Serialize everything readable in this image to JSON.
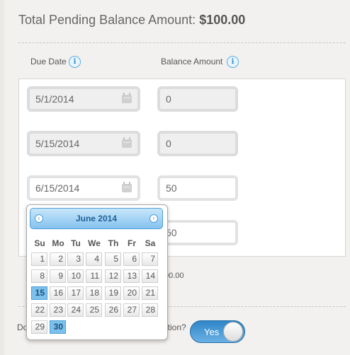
{
  "header": {
    "title_prefix": "Total Pending Balance Amount:",
    "title_amount": "$100.00"
  },
  "columns": {
    "due_date": "Due Date",
    "balance_amount": "Balance Amount",
    "info_glyph": "i"
  },
  "rows": [
    {
      "date": "5/1/2014",
      "amount": "0",
      "active": false
    },
    {
      "date": "5/15/2014",
      "amount": "0",
      "active": false
    },
    {
      "date": "6/15/2014",
      "amount": "50",
      "active": true
    },
    {
      "amount": "50",
      "active": true
    }
  ],
  "total_fragment": "00.00",
  "question": {
    "start": "Do",
    "end": "ation?"
  },
  "toggle": {
    "label": "Yes"
  },
  "datepicker": {
    "month_label": "June 2014",
    "prev": "‹",
    "next": "›",
    "weekdays": [
      "Su",
      "Mo",
      "Tu",
      "We",
      "Th",
      "Fr",
      "Sa"
    ],
    "weeks": [
      [
        "1",
        "2",
        "3",
        "4",
        "5",
        "6",
        "7"
      ],
      [
        "8",
        "9",
        "10",
        "11",
        "12",
        "13",
        "14"
      ],
      [
        "15",
        "16",
        "17",
        "18",
        "19",
        "20",
        "21"
      ],
      [
        "22",
        "23",
        "24",
        "25",
        "26",
        "27",
        "28"
      ],
      [
        "29",
        "30",
        "",
        "",
        "",
        "",
        ""
      ]
    ],
    "selected": [
      "15",
      "30"
    ]
  },
  "icons": {
    "calendar": "calendar-icon",
    "info": "info-icon",
    "prev": "chevron-left-icon",
    "next": "chevron-right-icon"
  }
}
